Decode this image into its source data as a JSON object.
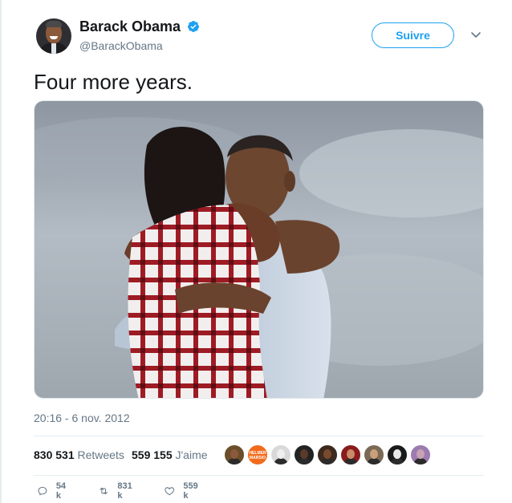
{
  "author": {
    "name": "Barack Obama",
    "handle": "@BarackObama",
    "verified": true,
    "avatar_icon": "avatar-photo"
  },
  "follow_button": {
    "label": "Suivre"
  },
  "menu": {
    "icon": "chevron-down-icon"
  },
  "tweet": {
    "text": "Four more years.",
    "media": {
      "type": "photo"
    },
    "timestamp": "20:16 - 6 nov. 2012"
  },
  "stats": {
    "retweets_count": "830 531",
    "retweets_label": "Retweets",
    "likes_count": "559 155",
    "likes_label": "J'aime"
  },
  "likers": [
    {
      "name": "liker-1",
      "color": "#6b4e2a"
    },
    {
      "name": "liker-2",
      "color": "#f26b1d",
      "text": "HELMER\nMARSIO"
    },
    {
      "name": "liker-3",
      "color": "#d9d9d9"
    },
    {
      "name": "liker-4",
      "color": "#222222"
    },
    {
      "name": "liker-5",
      "color": "#3c2a1e"
    },
    {
      "name": "liker-6",
      "color": "#8a1c1c"
    },
    {
      "name": "liker-7",
      "color": "#7a6a55"
    },
    {
      "name": "liker-8",
      "color": "#1a1a1a"
    },
    {
      "name": "liker-9",
      "color": "#9b7bb0"
    }
  ],
  "actions": {
    "reply_count": "54 k",
    "retweet_count": "831 k",
    "like_count": "559 k"
  },
  "colors": {
    "accent": "#1da1f2",
    "text_primary": "#14171a",
    "text_secondary": "#657786",
    "divider": "#e6ecf0"
  }
}
